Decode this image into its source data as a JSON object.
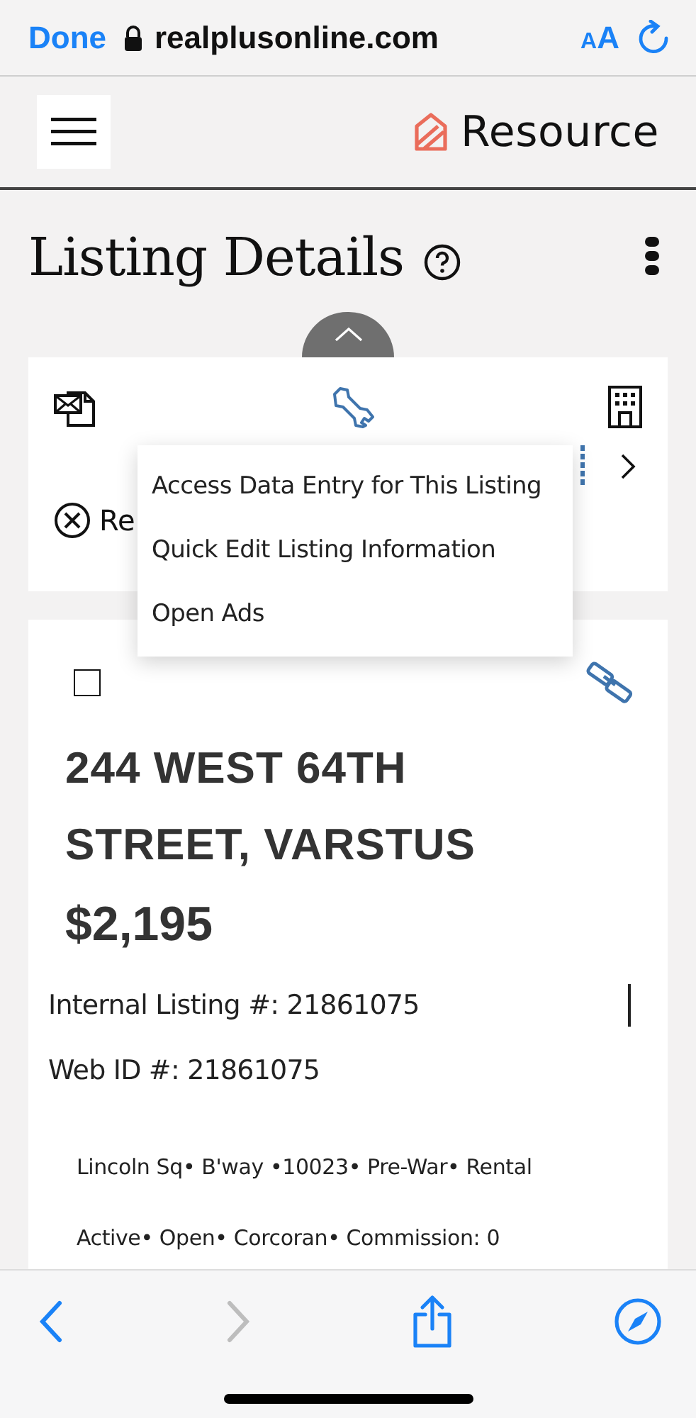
{
  "browser": {
    "done": "Done",
    "url": "realplusonline.com",
    "text_size": "AA"
  },
  "header": {
    "logo_text": "Resource"
  },
  "page": {
    "title": "Listing Details"
  },
  "actions": {
    "partial_label": "Re"
  },
  "menu": [
    {
      "label": "Access Data Entry for This Listing"
    },
    {
      "label": "Quick Edit Listing Information"
    },
    {
      "label": "Open Ads"
    }
  ],
  "listing": {
    "checked": false,
    "address": "244 WEST 64TH STREET, VARSTUS",
    "price": "$2,195",
    "internal_id": "Internal Listing #: 21861075",
    "web_id": "Web ID #: 21861075",
    "tag_lines": [
      "Lincoln Sq• B'way •10023• Pre-War• Rental",
      "Active• Open• Corcoran• Commission: 0"
    ]
  },
  "toolbar": {
    "forward_disabled": true
  }
}
